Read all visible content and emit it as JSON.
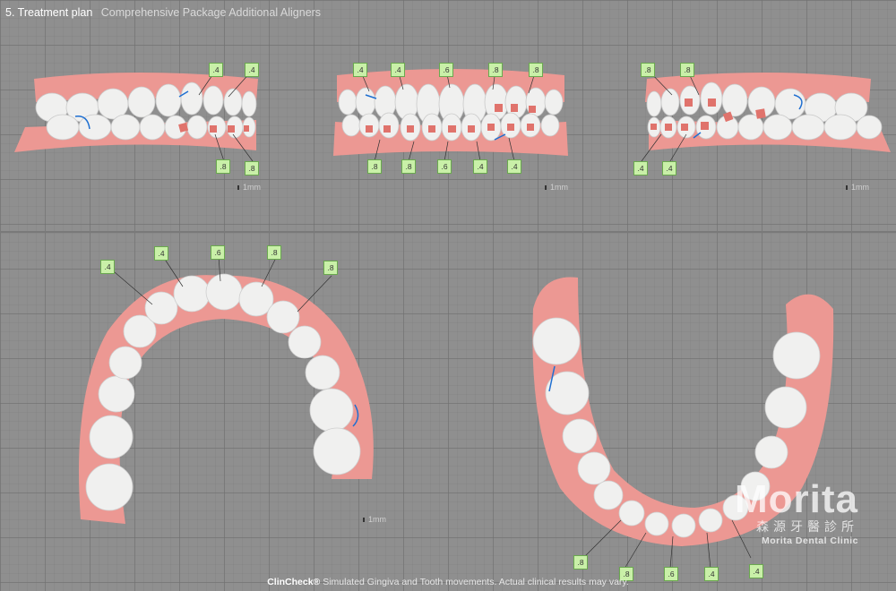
{
  "header": {
    "step": "5. Treatment plan",
    "package": "Comprehensive Package Additional Aligners"
  },
  "scale_label": "1mm",
  "views": {
    "right": {
      "tags_top": [
        ".4",
        ".4"
      ],
      "tags_bottom": [
        ".8",
        ".8"
      ]
    },
    "front": {
      "tags_top": [
        ".4",
        ".4",
        ".6",
        ".8",
        ".8"
      ],
      "tags_bottom": [
        ".8",
        ".8",
        ".6",
        ".4",
        ".4"
      ]
    },
    "left": {
      "tags_top": [
        ".8",
        ".8"
      ],
      "tags_bottom": [
        ".4",
        ".4"
      ]
    },
    "upper": {
      "tags": [
        ".4",
        ".4",
        ".6",
        ".8",
        ".8"
      ]
    },
    "lower": {
      "tags": [
        ".8",
        ".8",
        ".6",
        ".4",
        ".4"
      ]
    }
  },
  "footer": {
    "brand": "ClinCheck®",
    "disclaimer": "Simulated Gingiva and Tooth movements. Actual clinical results may vary."
  },
  "logo": {
    "text": "Morita",
    "chinese": "森源牙醫診所",
    "english": "Morita Dental Clinic"
  },
  "colors": {
    "gum": "#e88f8a",
    "tooth": "#efefef",
    "tag_bg": "#c9f0a8",
    "attachment": "#e0736c",
    "wire": "#1f6fd1"
  }
}
